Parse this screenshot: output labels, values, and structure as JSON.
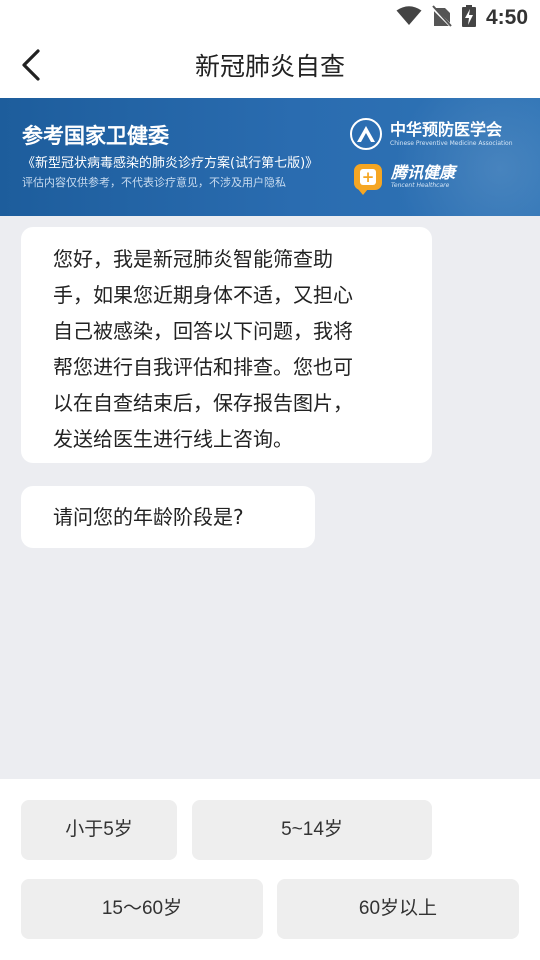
{
  "status_bar": {
    "time": "4:50",
    "icons": [
      "wifi-icon",
      "no-sim-icon",
      "battery-charging-icon"
    ]
  },
  "nav": {
    "title": "新冠肺炎自查",
    "back_icon": "chevron-left-icon"
  },
  "banner": {
    "title": "参考国家卫健委",
    "subtitle": "《新型冠状病毒感染的肺炎诊疗方案(试行第七版)》",
    "disclaimer": "评估内容仅供参考，不代表诊疗意见，不涉及用户隐私",
    "org1_name": "中华预防医学会",
    "org1_en": "Chinese Preventive Medicine Association",
    "org2_name": "腾讯健康",
    "org2_en": "Tencent Healthcare",
    "colors": {
      "background": "#2a6cb0",
      "tencent_accent": "#f5a623"
    }
  },
  "chat": {
    "greeting_lines": [
      "您好，我是新冠肺炎智能筛查助",
      "手，如果您近期身体不适，又担心",
      "自己被感染，回答以下问题，我将",
      "帮您进行自我评估和排查。您也可",
      "以在自查结束后，保存报告图片，",
      "发送给医生进行线上咨询。"
    ],
    "question": "请问您的年龄阶段是?"
  },
  "answers": {
    "options": [
      "小于5岁",
      "5~14岁",
      "15～60岁",
      "60岁以上"
    ]
  }
}
